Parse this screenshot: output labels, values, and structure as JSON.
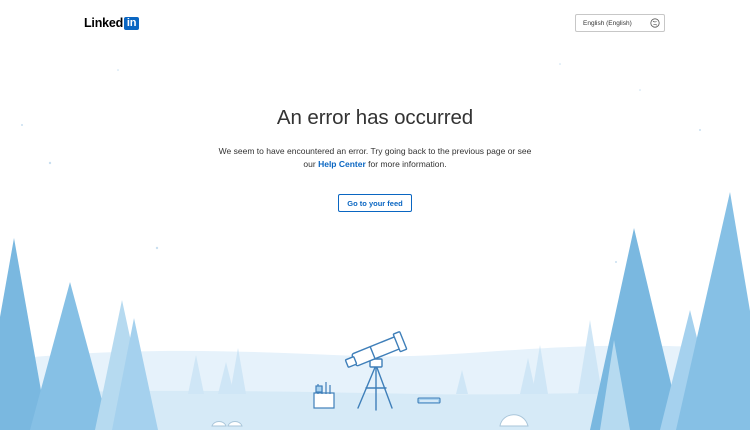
{
  "header": {
    "logo_text": "Linked",
    "logo_box_text": "in",
    "language_selected": "English (English)",
    "language_icon": "globe-icon"
  },
  "main": {
    "title": "An error has occurred",
    "message_part1": "We seem to have encountered an error. Try going back to the previous page or see our ",
    "help_center_label": "Help Center",
    "message_part2": " for more information.",
    "feed_button_label": "Go to your feed"
  },
  "colors": {
    "brand_blue": "#0a66c2",
    "tree_dark": "#7ab8e0",
    "tree_light": "#b6daf0",
    "ground": "#d9ecf8",
    "text": "#333333"
  },
  "illustration": {
    "telescope_icon": "telescope-icon",
    "bucket_icon": "bucket-icon",
    "book_icon": "book-icon"
  }
}
